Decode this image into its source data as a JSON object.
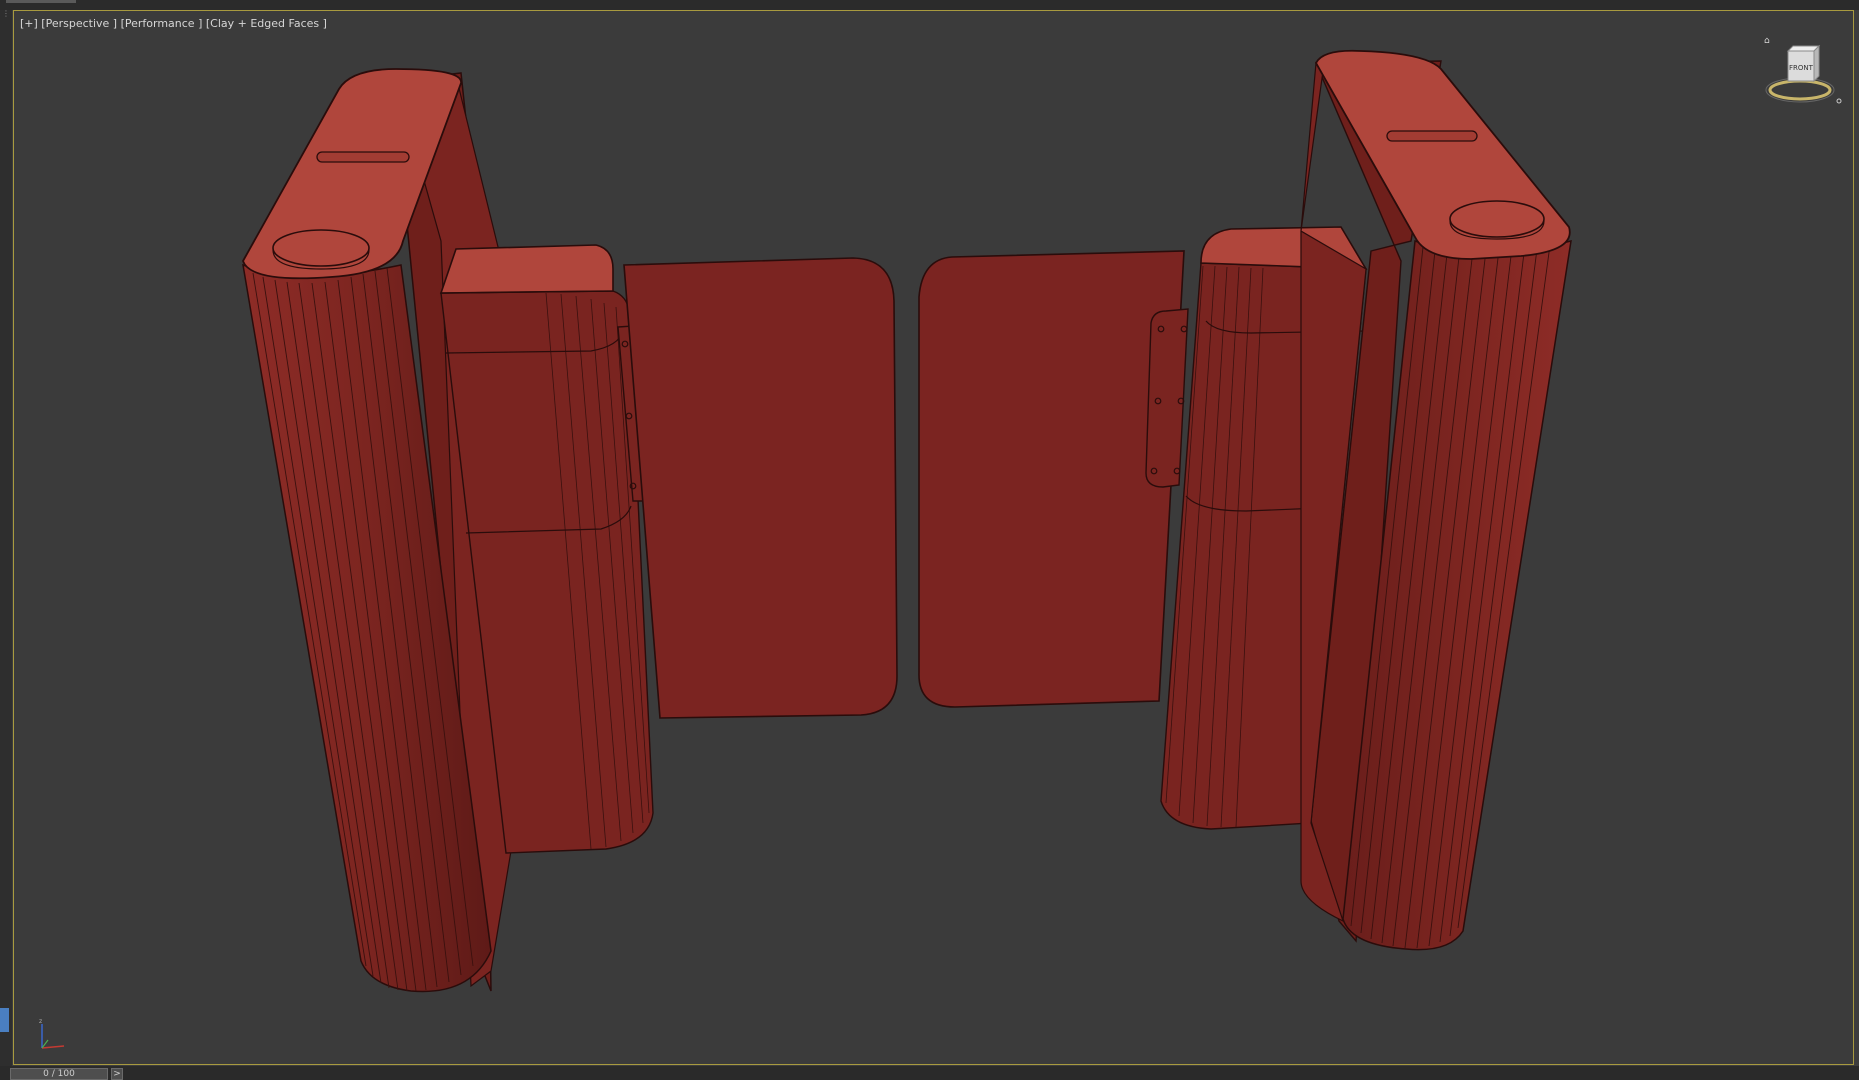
{
  "viewport": {
    "label": "[+] [Perspective ] [Performance ] [Clay + Edged Faces ]",
    "view_type": "Perspective",
    "shading_mode": "Clay + Edged Faces",
    "border_color": "#a89a3f",
    "background_color": "#3b3b3b"
  },
  "viewcube": {
    "face_label": "FRONT",
    "icon": "home-icon"
  },
  "timeline": {
    "frame_readout": "0 / 100",
    "next_icon": ">"
  },
  "model": {
    "material_color": "#a73a30",
    "material_dark": "#7a2220",
    "edge_color": "#1f0b0a"
  }
}
